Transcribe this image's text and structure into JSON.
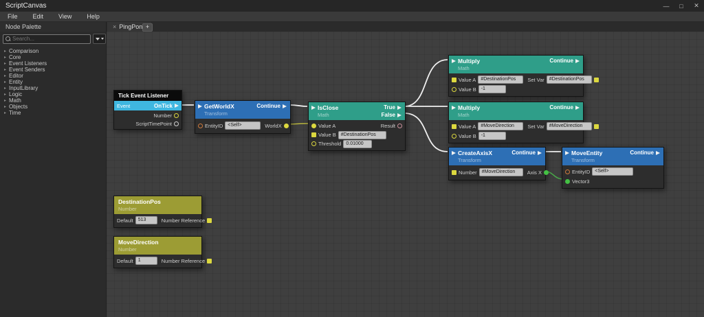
{
  "window": {
    "title": "ScriptCanvas",
    "controls": {
      "minimize": "—",
      "maximize": "□",
      "close": "✕"
    }
  },
  "menu": {
    "items": [
      "File",
      "Edit",
      "View",
      "Help"
    ]
  },
  "tabs": {
    "palette_title": "Node Palette",
    "active_tab": "PingPong",
    "close_icon": "×",
    "add_icon": "+"
  },
  "palette": {
    "search_placeholder": "Search...",
    "caret": "▸",
    "items": [
      "Comparison",
      "Core",
      "Event Listeners",
      "Event Senders",
      "Editor",
      "Entity",
      "InputLibrary",
      "Logic",
      "Math",
      "Objects",
      "Time"
    ]
  },
  "nodes": {
    "tick": {
      "title": "Tick Event Listener",
      "event": "Event",
      "on_tick": "OnTick",
      "number": "Number",
      "script_time_point": "ScriptTimePoint"
    },
    "get_world_x": {
      "title": "GetWorldX",
      "subtitle": "Transform",
      "continue": "Continue",
      "entity_id": "EntityID",
      "entity_value": "<Self>",
      "world_x": "WorldX"
    },
    "is_close": {
      "title": "IsClose",
      "subtitle": "Math",
      "true": "True",
      "false": "False",
      "value_a": "Value A",
      "value_b": "Value B",
      "value_b_value": "#DestinationPos",
      "threshold": "Threshold",
      "threshold_value": "0.01000",
      "result": "Result"
    },
    "multiply_top": {
      "title": "Multiply",
      "subtitle": "Math",
      "continue": "Continue",
      "value_a": "Value A",
      "value_a_value": "#DestinationPos",
      "value_b": "Value B",
      "value_b_value": "-1",
      "set_var": "Set Var",
      "set_var_value": "#DestinationPos"
    },
    "multiply_bottom": {
      "title": "Multiply",
      "subtitle": "Math",
      "continue": "Continue",
      "value_a": "Value A",
      "value_a_value": "#MoveDirection",
      "value_b": "Value B",
      "value_b_value": "-1",
      "set_var": "Set Var",
      "set_var_value": "#MoveDirection"
    },
    "create_axis_x": {
      "title": "CreateAxisX",
      "subtitle": "Transform",
      "continue": "Continue",
      "number": "Number",
      "number_value": "#MoveDirection",
      "axis_x": "Axis X"
    },
    "move_entity": {
      "title": "MoveEntity",
      "subtitle": "Transform",
      "continue": "Continue",
      "entity_id": "EntityID",
      "entity_value": "<Self>",
      "vector3": "Vector3"
    },
    "var_destination_pos": {
      "title": "DestinationPos",
      "subtitle": "Number",
      "default_label": "Default",
      "default_value": "513",
      "reference_label": "Number Reference"
    },
    "var_move_direction": {
      "title": "MoveDirection",
      "subtitle": "Number",
      "default_label": "Default",
      "default_value": "1",
      "reference_label": "Number Reference"
    }
  },
  "colors": {
    "header_blue": "#2d6fb5",
    "header_teal": "#2f9e89",
    "header_variable": "#9c9c34",
    "header_black": "#0b0b0b",
    "event_row_cyan": "#3fb7e0",
    "pin_number_yellow": "#dcd83f",
    "pin_entity_orange": "#cf7a3c",
    "pin_vector_green": "#44c144",
    "pin_boolean_pink": "#c9909a",
    "wire_exec": "#f0f0f0",
    "wire_number": "#b9b63e",
    "wire_vector": "#4aa84a"
  },
  "connections": [
    {
      "from": "Tick Event Listener.OnTick",
      "to": "GetWorldX.In",
      "type": "exec"
    },
    {
      "from": "GetWorldX.Continue",
      "to": "IsClose.In",
      "type": "exec"
    },
    {
      "from": "GetWorldX.WorldX",
      "to": "IsClose.Value A",
      "type": "number"
    },
    {
      "from": "IsClose.True",
      "to": "Multiply(DestinationPos).In",
      "type": "exec"
    },
    {
      "from": "IsClose.True",
      "to": "Multiply(MoveDirection).In",
      "type": "exec"
    },
    {
      "from": "IsClose.False",
      "to": "CreateAxisX.In",
      "type": "exec"
    },
    {
      "from": "CreateAxisX.Continue",
      "to": "MoveEntity.In",
      "type": "exec"
    },
    {
      "from": "CreateAxisX.Axis X",
      "to": "MoveEntity.Vector3",
      "type": "vector3"
    }
  ]
}
